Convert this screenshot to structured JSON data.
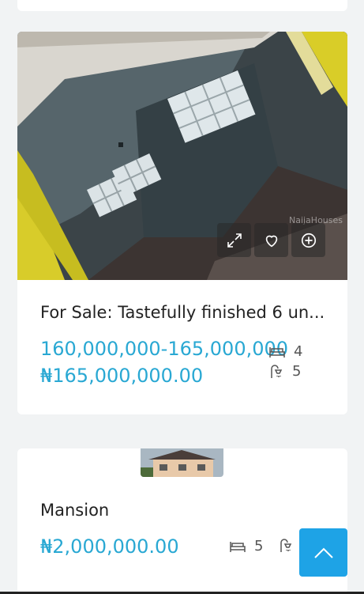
{
  "listings": [
    {
      "title": "For Sale: Tastefully finished 6 un...",
      "price_range": "160,000,000-165,000,000",
      "price": "₦165,000,000.00",
      "bedrooms": "4",
      "bathrooms": "5",
      "watermark": "NaijaHouses",
      "actions": [
        "expand-icon",
        "heart-icon",
        "plus-circle-icon"
      ]
    },
    {
      "title": "Mansion",
      "price": "₦2,000,000.00",
      "bedrooms": "5",
      "bathrooms": ""
    }
  ],
  "colors": {
    "accent": "#29a8d3",
    "scroll_button": "#1ea3e6"
  },
  "scroll_top_icon": "chevron-up-icon"
}
